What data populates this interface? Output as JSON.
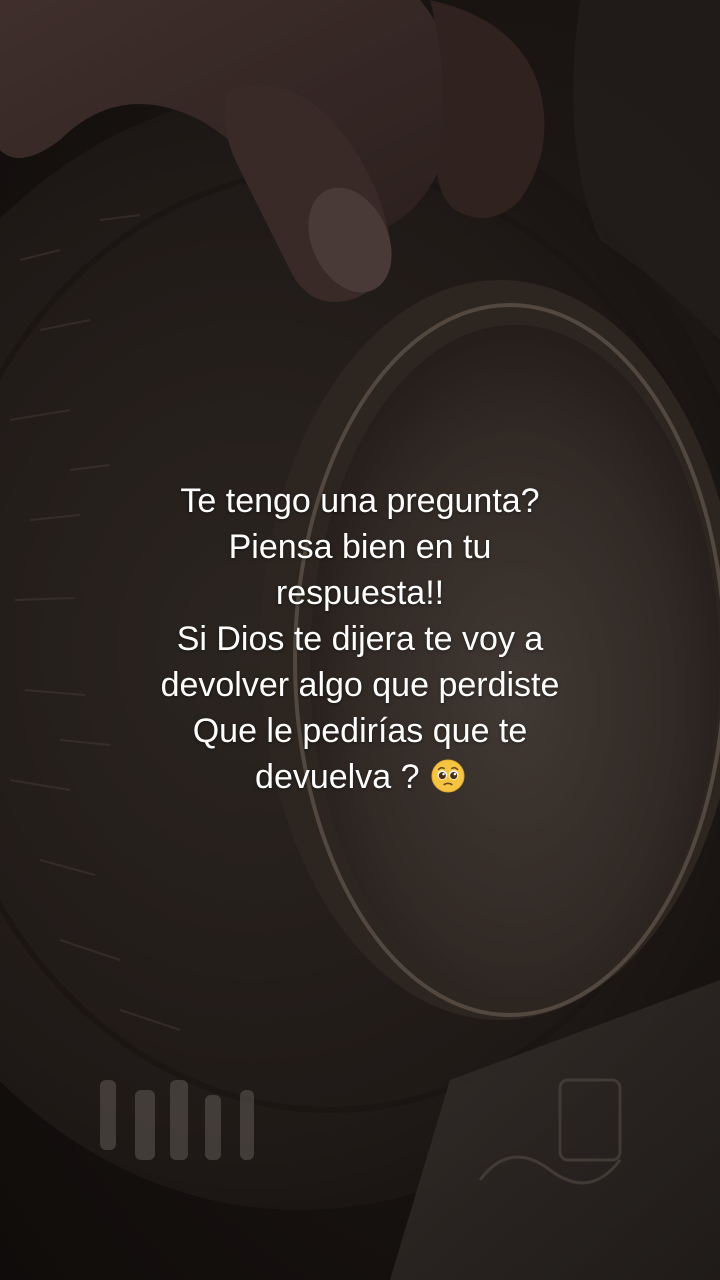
{
  "caption": {
    "lines": [
      "Te tengo una pregunta?",
      "Piensa bien en tu",
      "respuesta!!",
      "Si Dios te dijera te voy a",
      "devolver algo que perdiste",
      "Que le pedirías que te",
      "devuelva ?"
    ],
    "emoji": "pleading-face-emoji"
  },
  "colors": {
    "text": "#ffffff",
    "emoji_face": "#f6c443",
    "background_dark": "#1a1614",
    "saucer": "#2b2622",
    "cup_liquid": "#4a403a",
    "cup_rim": "#8d7f6f",
    "fingers": "#4b3734"
  }
}
